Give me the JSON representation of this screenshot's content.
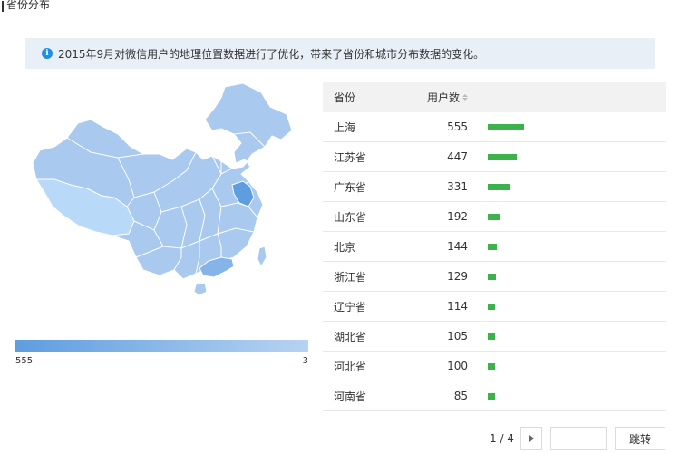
{
  "header": {
    "title": "省份分布"
  },
  "notice": {
    "icon": "info-icon",
    "text": "2015年9月对微信用户的地理位置数据进行了优化，带来了省份和城市分布数据的变化。"
  },
  "legend": {
    "max_label": "555",
    "min_label": "3",
    "colors": {
      "high": "#5e9de0",
      "low": "#b7d3f2"
    }
  },
  "table": {
    "columns": {
      "province": "省份",
      "users": "用户数"
    },
    "rows": [
      {
        "province": "上海",
        "users": "555"
      },
      {
        "province": "江苏省",
        "users": "447"
      },
      {
        "province": "广东省",
        "users": "331"
      },
      {
        "province": "山东省",
        "users": "192"
      },
      {
        "province": "北京",
        "users": "144"
      },
      {
        "province": "浙江省",
        "users": "129"
      },
      {
        "province": "辽宁省",
        "users": "114"
      },
      {
        "province": "湖北省",
        "users": "105"
      },
      {
        "province": "河北省",
        "users": "100"
      },
      {
        "province": "河南省",
        "users": "85"
      }
    ],
    "bar_color": "#3bb34a"
  },
  "pagination": {
    "page": "1 / 4",
    "input_value": "",
    "jump_label": "跳转"
  }
}
